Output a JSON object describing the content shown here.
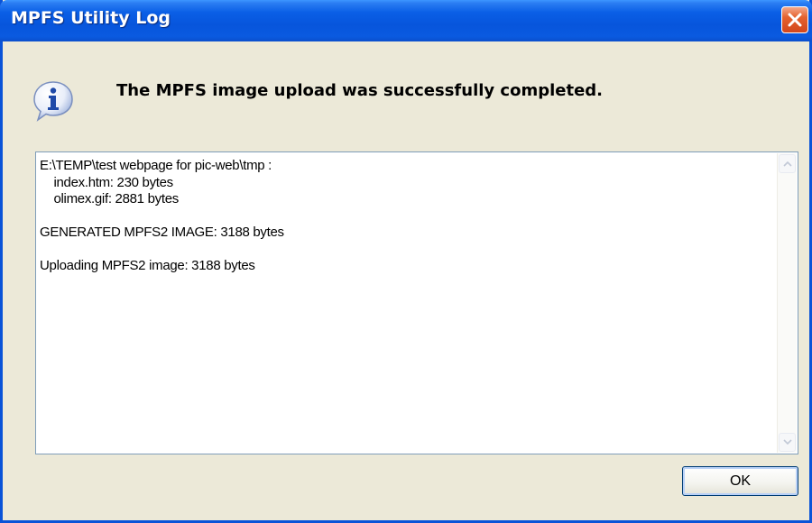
{
  "window": {
    "title": "MPFS Utility Log",
    "close_icon": "close-icon"
  },
  "message": {
    "icon": "info-icon",
    "text": "The MPFS image upload was successfully completed."
  },
  "log": {
    "lines": [
      "E:\\TEMP\\test webpage for pic-web\\tmp :",
      "    index.htm: 230 bytes",
      "    olimex.gif: 2881 bytes",
      "",
      "GENERATED MPFS2 IMAGE: 3188 bytes",
      "",
      "Uploading MPFS2 image: 3188 bytes"
    ]
  },
  "buttons": {
    "ok_label": "OK"
  },
  "colors": {
    "titlebar": "#0755dc",
    "close_button": "#d2461b",
    "dialog_background": "#ece9d8"
  }
}
